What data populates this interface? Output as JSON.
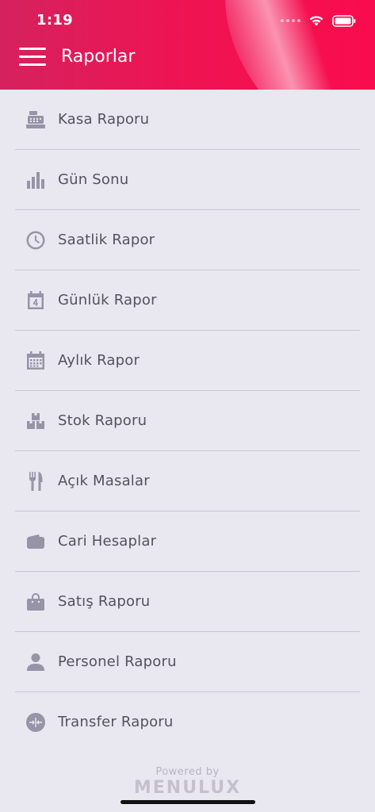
{
  "status_bar": {
    "time": "1:19"
  },
  "header": {
    "title": "Raporlar"
  },
  "menu": [
    {
      "label": "Kasa Raporu",
      "icon": "cash-register-icon"
    },
    {
      "label": "Gün Sonu",
      "icon": "bar-chart-icon"
    },
    {
      "label": "Saatlik Rapor",
      "icon": "clock-icon"
    },
    {
      "label": "Günlük Rapor",
      "icon": "calendar-day-icon"
    },
    {
      "label": "Aylık Rapor",
      "icon": "calendar-month-icon"
    },
    {
      "label": "Stok Raporu",
      "icon": "boxes-icon"
    },
    {
      "label": "Açık Masalar",
      "icon": "fork-knife-icon"
    },
    {
      "label": "Cari Hesaplar",
      "icon": "wallet-icon"
    },
    {
      "label": "Satış Raporu",
      "icon": "shopping-bag-icon"
    },
    {
      "label": "Personel Raporu",
      "icon": "person-icon"
    },
    {
      "label": "Transfer Raporu",
      "icon": "transfer-icon"
    }
  ],
  "footer": {
    "powered_by": "Powered by",
    "brand": "MENULUX"
  },
  "colors": {
    "header_start": "#d4225f",
    "header_end": "#f90c4e",
    "icon": "#9794a8",
    "background": "#e9e7f0"
  }
}
